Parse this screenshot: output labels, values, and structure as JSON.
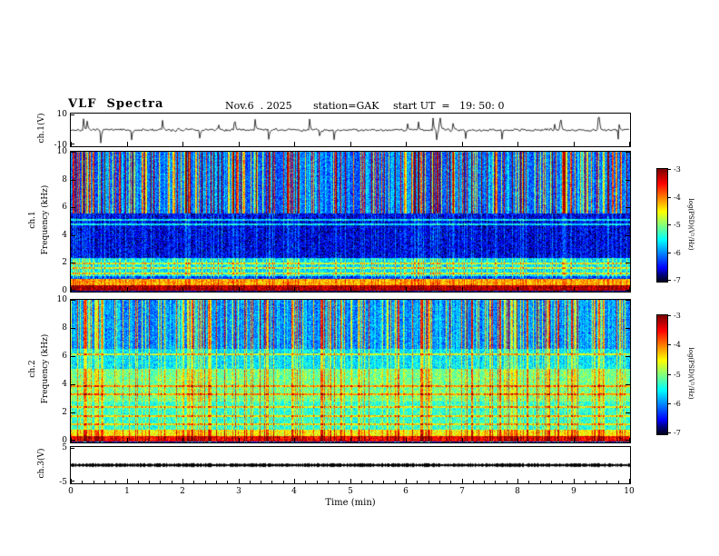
{
  "header": {
    "title": "VLF  Spectra",
    "date": "Nov.6  . 2025",
    "station": "station=GAK",
    "start_ut": "start UT  =   19: 50: 0"
  },
  "panels": {
    "ch1_wave": {
      "ylabel": "ch.1(V)",
      "yticks": [
        "10",
        "-10"
      ]
    },
    "ch1_spec": {
      "ylabel_channel": "ch.1",
      "ylabel_axis": "Frequency  (kHz)",
      "yticks": [
        "10",
        "8",
        "6",
        "4",
        "2",
        "0"
      ]
    },
    "ch2_spec": {
      "ylabel_channel": "ch.2",
      "ylabel_axis": "Frequency  (kHz)",
      "yticks": [
        "10",
        "8",
        "6",
        "4",
        "2",
        "0"
      ]
    },
    "ch3_wave": {
      "ylabel": "ch.3(V)",
      "yticks": [
        "5",
        "-5"
      ]
    }
  },
  "xaxis": {
    "label": "Time  (min)",
    "ticks": [
      "0",
      "1",
      "2",
      "3",
      "4",
      "5",
      "6",
      "7",
      "8",
      "9",
      "10"
    ]
  },
  "colorbars": [
    {
      "label": "log(PSD)(V²/Hz)",
      "ticks": [
        "-3",
        "-4",
        "-5",
        "-6",
        "-7"
      ]
    },
    {
      "label": "log(PSD)(V²/Hz)",
      "ticks": [
        "-3",
        "-4",
        "-5",
        "-6",
        "-7"
      ]
    }
  ],
  "chart_data": [
    {
      "type": "line",
      "title": "ch.1(V) time series",
      "xlabel": "Time (min)",
      "xlim": [
        0,
        10
      ],
      "ylabel": "ch.1(V)",
      "ylim": [
        -10,
        10
      ],
      "description": "continuous broadband noise centered on 0 V, typical amplitude about ±2 V, with frequent impulsive spikes reaching roughly ±8 V"
    },
    {
      "type": "heatmap",
      "title": "ch.1 VLF spectrogram",
      "xlabel": "Time (min)",
      "xlim": [
        0,
        10
      ],
      "ylabel": "Frequency (kHz)",
      "ylim": [
        0,
        10
      ],
      "zlabel": "log(PSD)(V²/Hz)",
      "zlim": [
        -7,
        -3
      ],
      "bands": [
        {
          "f_khz": [
            0,
            0.12
          ],
          "log_psd": -6.8
        },
        {
          "f_khz": [
            0.12,
            0.5
          ],
          "log_psd": -3.3
        },
        {
          "f_khz": [
            0.5,
            0.95
          ],
          "log_psd": -4.3
        },
        {
          "f_khz": [
            0.95,
            1.15
          ],
          "log_psd": -6.4
        },
        {
          "f_khz": [
            1.15,
            2.4
          ],
          "log_psd": -5.7
        },
        {
          "f_khz": [
            2.4,
            5.6
          ],
          "log_psd": -6.6
        },
        {
          "f_khz": [
            5.6,
            10.01
          ],
          "log_psd": -6.25
        }
      ],
      "line_features_khz": [
        1.35,
        1.7,
        2.05,
        2.4,
        4.85,
        5.15
      ],
      "features": "dense vertical sferic streaks, strongest above ~5.5 kHz, reaching log PSD near -3.5; intense band below 1 kHz; narrow horizontal enhancement lines near 1.4-2.4 kHz and ~5 kHz; dark-blue quiet region 2.5-5.5 kHz"
    },
    {
      "type": "heatmap",
      "title": "ch.2 VLF spectrogram",
      "xlabel": "Time (min)",
      "xlim": [
        0,
        10
      ],
      "ylabel": "Frequency (kHz)",
      "ylim": [
        0,
        10
      ],
      "zlabel": "log(PSD)(V²/Hz)",
      "zlim": [
        -7,
        -3
      ],
      "bands": [
        {
          "f_khz": [
            0,
            0.12
          ],
          "log_psd": -6.8
        },
        {
          "f_khz": [
            0.12,
            0.5
          ],
          "log_psd": -3.6
        },
        {
          "f_khz": [
            0.5,
            0.95
          ],
          "log_psd": -4.6
        },
        {
          "f_khz": [
            0.95,
            2.9
          ],
          "log_psd": -5.45
        },
        {
          "f_khz": [
            2.9,
            5.2
          ],
          "log_psd": -5.15
        },
        {
          "f_khz": [
            5.2,
            6.6
          ],
          "log_psd": -5.7
        },
        {
          "f_khz": [
            6.6,
            10.01
          ],
          "log_psd": -6.1
        }
      ],
      "line_features_khz": [
        1.3,
        1.9,
        2.5,
        3.4,
        4.0,
        6.2
      ],
      "features": "overall higher (greener) background than ch.1; vertical sferic streaks spanning the full band reaching log PSD near -3.5; intense band below 1 kHz"
    },
    {
      "type": "line",
      "title": "ch.3(V) time series",
      "xlabel": "Time (min)",
      "xlim": [
        0,
        10
      ],
      "ylabel": "ch.3(V)",
      "ylim": [
        -5,
        5
      ],
      "description": "flat trace at 0 V with very small noise (< ±0.5 V), appearing as a solid dark band"
    }
  ]
}
